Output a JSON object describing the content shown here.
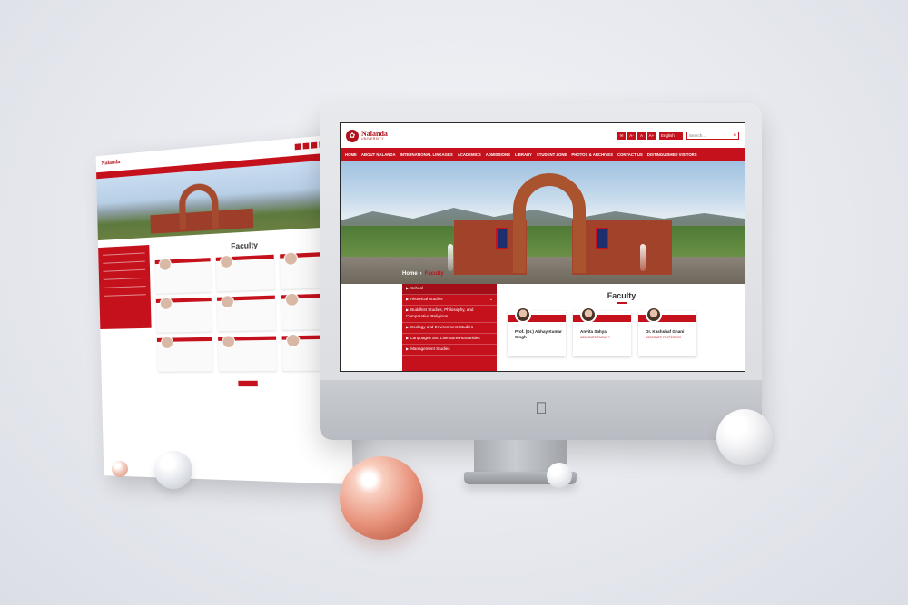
{
  "site": {
    "logo_name": "Nalanda",
    "logo_sub": "UNIVERSITY",
    "tools": [
      "A-",
      "A",
      "A+"
    ],
    "language": "English",
    "search_placeholder": "Search..."
  },
  "nav": {
    "items": [
      "HOME",
      "ABOUT NALANDA",
      "INTERNATIONAL LINKAGES",
      "ACADEMICS",
      "ADMISSIONS",
      "LIBRARY",
      "STUDENT ZONE",
      "PHOTOS & ARCHIVES",
      "CONTACT US",
      "DISTINGUISHED VISITORS"
    ]
  },
  "breadcrumb": {
    "home": "Home",
    "separator": "›",
    "current": "Faculty"
  },
  "sidebar": {
    "items": [
      "School",
      "Historical Studies",
      "Buddhist Studies, Philosophy, and Comparative Religions",
      "Ecology and Environment Studies",
      "Languages and Literature/Humanities",
      "Management Studies"
    ]
  },
  "faculty": {
    "title": "Faculty",
    "cards": [
      {
        "name": "Prof. (Dr.) Abhay Kumar Singh",
        "role": ""
      },
      {
        "name": "Anvita Sahyal",
        "role": "ASSOCIATE FACULTY"
      },
      {
        "name": "Dr. Kashshaf Ghani",
        "role": "ASSOCIATE PROFESSOR"
      }
    ]
  },
  "paper": {
    "logo": "Nalanda",
    "title": "Faculty"
  },
  "colors": {
    "brand_red": "#c4111c",
    "background": "#e6e8ee"
  }
}
